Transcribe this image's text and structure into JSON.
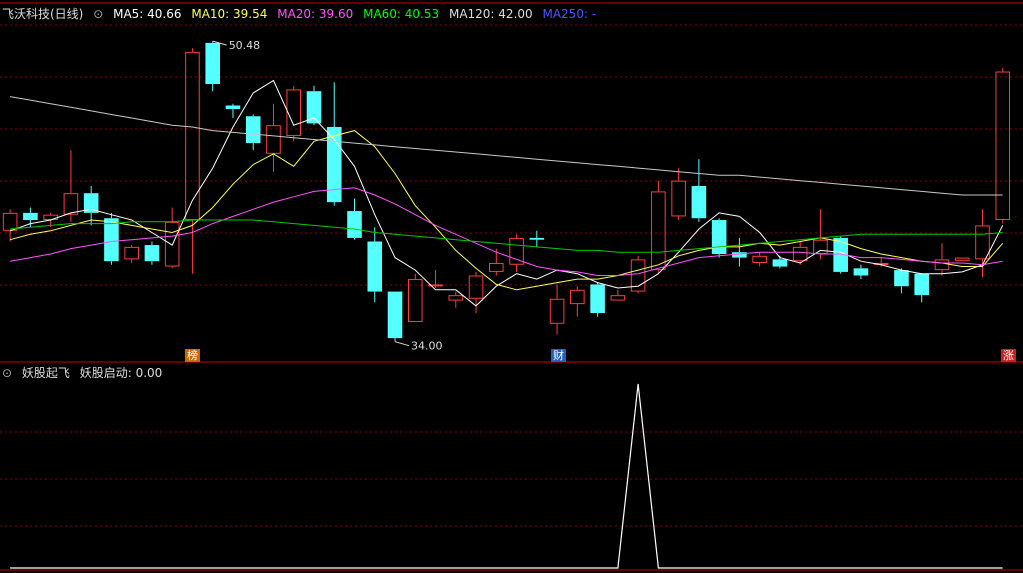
{
  "header": {
    "title": "飞沃科技(日线)",
    "ma5": "MA5: 40.66",
    "ma10": "MA10: 39.54",
    "ma20": "MA20: 39.60",
    "ma60": "MA60: 40.53",
    "ma120": "MA120: 42.00",
    "ma250": "MA250: -"
  },
  "indicator": {
    "name": "妖股起飞",
    "label": "妖股启动: 0.00"
  },
  "markers": {
    "m1": "榜",
    "m2": "财",
    "m3": "涨"
  },
  "annotations": {
    "high": "50.48",
    "low": "34.00"
  },
  "colors": {
    "up": "#ff3c3c",
    "down": "#54ffff",
    "ma5": "#ffffff",
    "ma10": "#ffff54",
    "ma20": "#ff54ff",
    "ma60": "#00cc00",
    "ma120": "#c8c8c8",
    "ma250": "#3c3cff",
    "grid": "#8b0000"
  },
  "chart_data": [
    {
      "type": "candlestick",
      "ylim": [
        33,
        51.5
      ],
      "candles": [
        [
          40.0,
          41.0,
          39.4,
          41.2
        ],
        [
          41.0,
          40.6,
          40.2,
          41.3
        ],
        [
          40.6,
          40.9,
          40.2,
          41.0
        ],
        [
          40.9,
          42.1,
          40.5,
          44.5
        ],
        [
          42.1,
          41.0,
          40.3,
          42.5
        ],
        [
          40.7,
          38.3,
          38.1,
          41.0
        ],
        [
          38.4,
          39.1,
          38.2,
          39.2
        ],
        [
          39.2,
          38.3,
          38.1,
          39.4
        ],
        [
          38.0,
          40.5,
          37.9,
          41.3
        ],
        [
          40.6,
          50.0,
          37.6,
          50.2
        ],
        [
          50.5,
          48.2,
          47.8,
          50.6
        ],
        [
          47.0,
          46.8,
          46.3,
          47.1
        ],
        [
          46.4,
          44.9,
          44.5,
          46.5
        ],
        [
          44.3,
          45.9,
          43.3,
          47.1
        ],
        [
          45.3,
          47.9,
          45.0,
          48.1
        ],
        [
          47.8,
          46.0,
          45.9,
          48.1
        ],
        [
          45.8,
          41.6,
          41.4,
          48.3
        ],
        [
          41.1,
          39.6,
          39.5,
          41.8
        ],
        [
          39.4,
          36.6,
          36.0,
          40.2
        ],
        [
          36.6,
          34.0,
          33.8,
          36.6
        ],
        [
          34.9,
          37.3,
          34.9,
          37.6
        ],
        [
          37.0,
          37.0,
          36.8,
          37.8
        ],
        [
          36.1,
          36.4,
          35.7,
          36.6
        ],
        [
          36.2,
          37.5,
          35.4,
          37.7
        ],
        [
          37.7,
          38.2,
          37.5,
          39.0
        ],
        [
          38.1,
          39.6,
          37.7,
          39.8
        ],
        [
          39.6,
          39.5,
          39.1,
          40.0
        ],
        [
          34.8,
          36.2,
          34.2,
          37.0
        ],
        [
          35.9,
          36.7,
          35.2,
          36.9
        ],
        [
          37.0,
          35.4,
          35.2,
          37.1
        ],
        [
          36.1,
          36.4,
          36.1,
          36.7
        ],
        [
          36.6,
          38.4,
          36.5,
          38.6
        ],
        [
          37.8,
          42.2,
          37.6,
          42.8
        ],
        [
          40.8,
          42.8,
          40.6,
          43.5
        ],
        [
          42.5,
          40.7,
          40.5,
          44.0
        ],
        [
          40.6,
          38.7,
          38.5,
          40.7
        ],
        [
          38.8,
          38.5,
          38.0,
          39.6
        ],
        [
          38.2,
          38.6,
          38.0,
          38.8
        ],
        [
          38.4,
          38.0,
          37.9,
          38.6
        ],
        [
          38.3,
          39.1,
          38.1,
          39.4
        ],
        [
          38.7,
          39.5,
          38.4,
          41.2
        ],
        [
          39.6,
          37.7,
          37.6,
          39.7
        ],
        [
          37.9,
          37.5,
          37.3,
          38.1
        ],
        [
          38.1,
          38.2,
          38.0,
          38.5
        ],
        [
          37.8,
          36.9,
          36.5,
          37.9
        ],
        [
          37.6,
          36.4,
          36.0,
          37.6
        ],
        [
          37.8,
          38.4,
          37.5,
          39.3
        ],
        [
          38.3,
          38.5,
          38.3,
          38.5
        ],
        [
          38.4,
          40.3,
          37.4,
          41.2
        ],
        [
          40.6,
          48.9,
          40.4,
          49.1
        ]
      ]
    },
    {
      "type": "line",
      "series": [
        {
          "name": "MA5",
          "values": [
            40.0,
            40.4,
            40.6,
            41.0,
            41.2,
            40.9,
            40.6,
            39.9,
            39.2,
            41.7,
            43.5,
            45.8,
            47.7,
            48.4,
            45.9,
            46.3,
            45.1,
            43.6,
            40.9,
            38.5,
            37.8,
            36.7,
            36.7,
            35.8,
            36.9,
            37.6,
            37.3,
            37.8,
            37.6,
            37.1,
            36.8,
            36.9,
            37.6,
            38.8,
            40.1,
            41.0,
            40.8,
            39.9,
            38.5,
            38.2,
            38.9,
            38.8,
            38.3,
            38.1,
            37.8,
            37.6,
            37.6,
            37.7,
            38.1,
            40.3
          ]
        },
        {
          "name": "MA10",
          "values": [
            39.5,
            39.8,
            40.0,
            40.3,
            40.6,
            40.5,
            40.3,
            40.1,
            39.9,
            40.3,
            41.3,
            42.6,
            43.7,
            44.3,
            43.6,
            45.0,
            45.3,
            45.6,
            44.7,
            43.2,
            41.4,
            40.2,
            38.9,
            37.9,
            37.0,
            36.7,
            36.9,
            37.1,
            37.3,
            37.3,
            37.5,
            37.8,
            38.1,
            38.6,
            38.9,
            39.1,
            39.1,
            39.3,
            39.2,
            39.4,
            39.6,
            39.4,
            39.0,
            38.7,
            38.5,
            38.3,
            38.2,
            38.0,
            38.0,
            39.3
          ]
        },
        {
          "name": "MA20",
          "values": [
            38.3,
            38.5,
            38.7,
            39.0,
            39.2,
            39.4,
            39.5,
            39.6,
            39.7,
            39.9,
            40.4,
            40.8,
            41.2,
            41.6,
            41.9,
            42.2,
            42.3,
            42.4,
            42.0,
            41.5,
            40.9,
            40.3,
            39.8,
            39.3,
            38.8,
            38.4,
            38.0,
            37.8,
            37.7,
            37.5,
            37.5,
            37.6,
            37.9,
            38.2,
            38.5,
            38.6,
            38.7,
            38.8,
            38.8,
            38.8,
            38.7,
            38.7,
            38.5,
            38.5,
            38.4,
            38.3,
            38.2,
            38.2,
            38.1,
            38.3
          ]
        },
        {
          "name": "MA60",
          "values": [
            40.1,
            40.2,
            40.3,
            40.4,
            40.4,
            40.4,
            40.5,
            40.5,
            40.5,
            40.6,
            40.6,
            40.6,
            40.6,
            40.5,
            40.4,
            40.3,
            40.2,
            40.1,
            39.9,
            39.8,
            39.7,
            39.6,
            39.5,
            39.4,
            39.3,
            39.2,
            39.1,
            39.0,
            38.9,
            38.9,
            38.8,
            38.8,
            38.8,
            38.9,
            39.0,
            39.1,
            39.2,
            39.3,
            39.4,
            39.5,
            39.6,
            39.7,
            39.8,
            39.8,
            39.8,
            39.8,
            39.8,
            39.8,
            39.8,
            39.9
          ]
        },
        {
          "name": "MA120",
          "values": [
            47.5,
            47.3,
            47.1,
            46.9,
            46.7,
            46.5,
            46.3,
            46.1,
            45.9,
            45.8,
            45.6,
            45.5,
            45.4,
            45.3,
            45.2,
            45.1,
            45.0,
            44.9,
            44.8,
            44.7,
            44.6,
            44.5,
            44.4,
            44.3,
            44.2,
            44.1,
            44.0,
            43.9,
            43.8,
            43.7,
            43.6,
            43.5,
            43.4,
            43.3,
            43.2,
            43.1,
            43.1,
            43.0,
            42.9,
            42.8,
            42.7,
            42.6,
            42.5,
            42.4,
            42.3,
            42.2,
            42.1,
            42.0,
            42.0,
            42.0
          ]
        }
      ]
    },
    {
      "type": "line",
      "name": "妖股启动",
      "ylim": [
        0,
        1
      ],
      "values": [
        0,
        0,
        0,
        0,
        0,
        0,
        0,
        0,
        0,
        0,
        0,
        0,
        0,
        0,
        0,
        0,
        0,
        0,
        0,
        0,
        0,
        0,
        0,
        0,
        0,
        0,
        0,
        0,
        0,
        0,
        0,
        1,
        0,
        0,
        0,
        0,
        0,
        0,
        0,
        0,
        0,
        0,
        0,
        0,
        0,
        0,
        0,
        0,
        0,
        0
      ]
    }
  ]
}
